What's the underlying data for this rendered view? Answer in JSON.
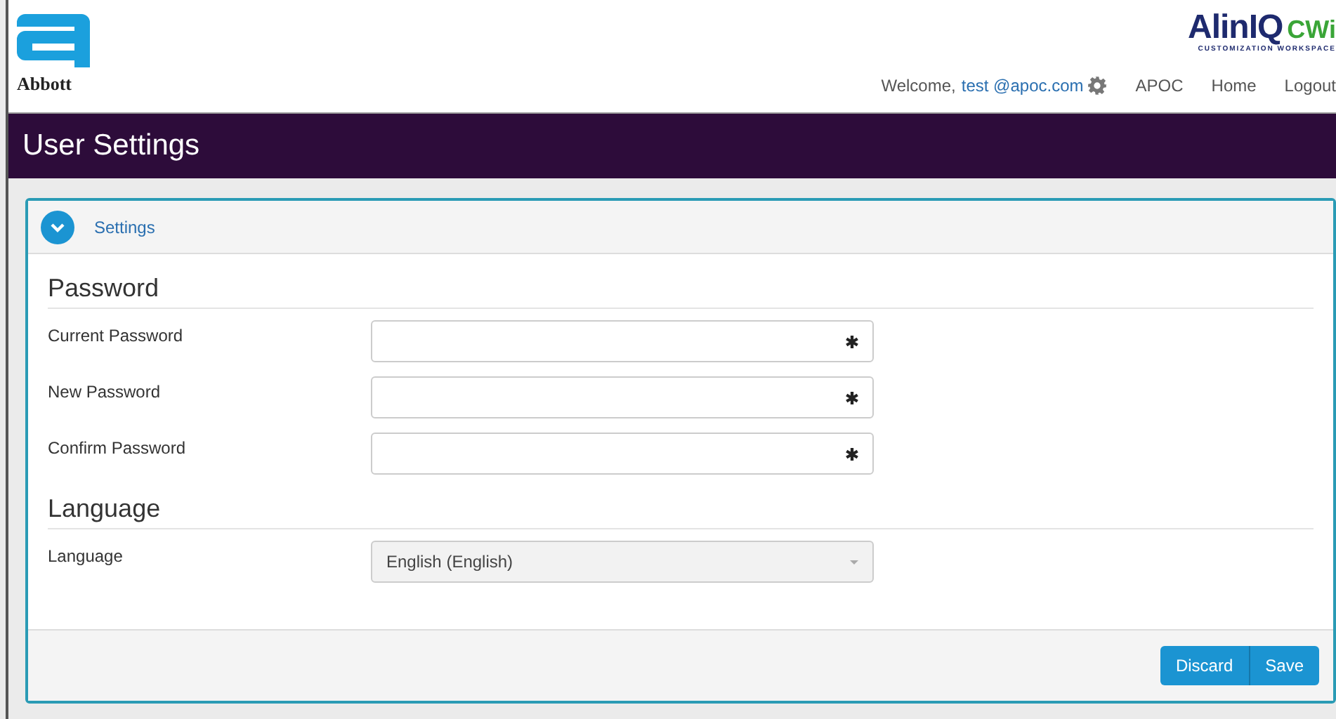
{
  "header": {
    "logo_text": "Abbott",
    "brand": {
      "name": "AlinIQ",
      "suffix": "CWi",
      "tagline": "CUSTOMIZATION WORKSPACE"
    },
    "welcome": "Welcome,",
    "user": "test @apoc.com",
    "nav": [
      "APOC",
      "Home",
      "Logout"
    ]
  },
  "title": "User Settings",
  "panel": {
    "title": "Settings",
    "expanded": true,
    "sections": [
      {
        "heading": "Password",
        "fields": [
          {
            "label": "Current Password",
            "kind": "password",
            "required": true
          },
          {
            "label": "New Password",
            "kind": "password",
            "required": true
          },
          {
            "label": "Confirm Password",
            "kind": "password",
            "required": true
          }
        ]
      },
      {
        "heading": "Language",
        "fields": [
          {
            "label": "Language",
            "kind": "select",
            "value": "English (English)"
          }
        ]
      }
    ],
    "buttons": [
      "Discard",
      "Save"
    ]
  }
}
